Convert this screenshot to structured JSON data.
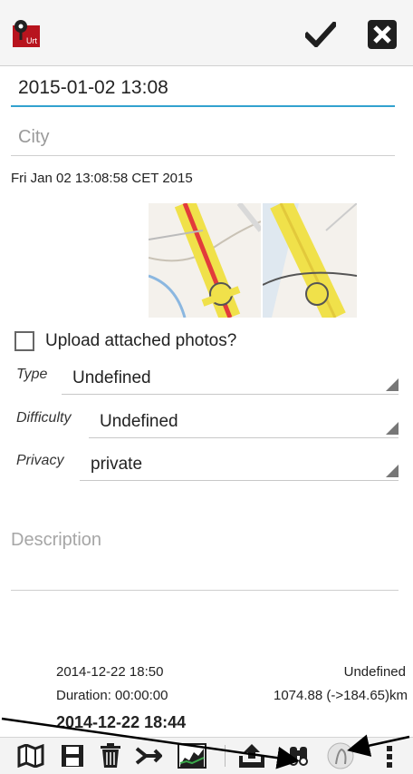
{
  "form": {
    "name_value": "2015-01-02 13:08",
    "city_placeholder": "City",
    "timestamp": "Fri Jan 02 13:08:58 CET 2015",
    "upload_label": "Upload attached photos?",
    "type_label": "Type",
    "type_value": "Undefined",
    "difficulty_label": "Difficulty",
    "difficulty_value": "Undefined",
    "privacy_label": "Privacy",
    "privacy_value": "private",
    "description_placeholder": "Description"
  },
  "list": {
    "row1_date": "2014-12-22 18:50",
    "row1_type": "Undefined",
    "row1_duration": "Duration: 00:00:00",
    "row1_distance": "1074.88 (->184.65)km",
    "row2_date": "2014-12-22 18:44"
  },
  "colors": {
    "accent": "#33a2cf",
    "app_icon_red": "#b8141e"
  },
  "icons": [
    "app-icon",
    "check-icon",
    "close-icon",
    "map-icon",
    "save-icon",
    "trash-icon",
    "join-icon",
    "chart-icon",
    "upload-icon",
    "search-icon",
    "avatar-icon",
    "overflow-icon"
  ]
}
